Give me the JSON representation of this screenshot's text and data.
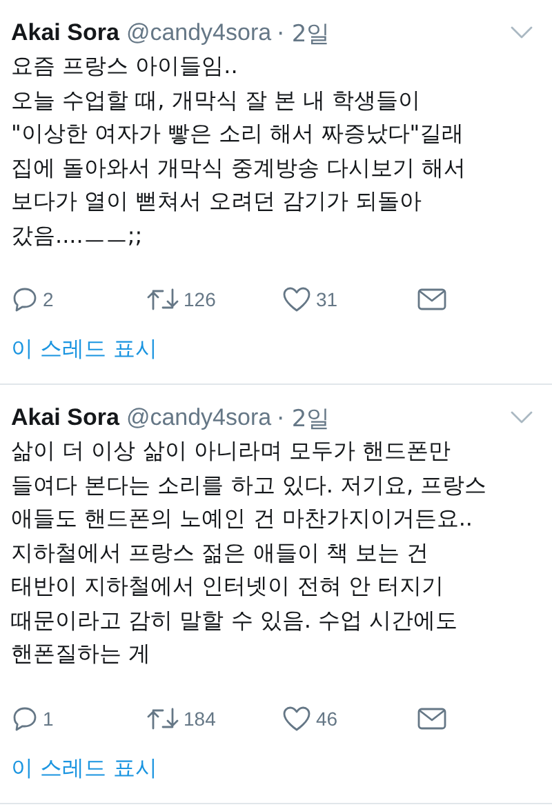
{
  "tweets": [
    {
      "name": "Akai Sora",
      "handle": "@candy4sora",
      "time": "· 2일",
      "body": "요즘 프랑스 아이들임..\n오늘 수업할 때, 개막식 잘 본 내 학생들이\n\"이상한 여자가 빻은 소리 해서 짜증났다\"길래\n집에 돌아와서 개막식 중계방송 다시보기 해서\n보다가 열이 뻗쳐서 오려던 감기가 되돌아\n갔음....ㅡㅡ;;",
      "replies": "2",
      "retweets": "126",
      "likes": "31",
      "thread_link": "이 스레드 표시"
    },
    {
      "name": "Akai Sora",
      "handle": "@candy4sora",
      "time": "· 2일",
      "body": "삶이 더 이상 삶이 아니라며 모두가 핸드폰만\n들여다 본다는 소리를 하고 있다. 저기요, 프랑스\n애들도 핸드폰의 노예인 건 마찬가지이거든요..\n지하철에서 프랑스 젊은 애들이 책 보는 건\n태반이 지하철에서 인터넷이 전혀 안 터지기\n때문이라고 감히 말할 수 있음. 수업 시간에도\n핸폰질하는 게",
      "replies": "1",
      "retweets": "184",
      "likes": "46",
      "thread_link": "이 스레드 표시"
    }
  ]
}
